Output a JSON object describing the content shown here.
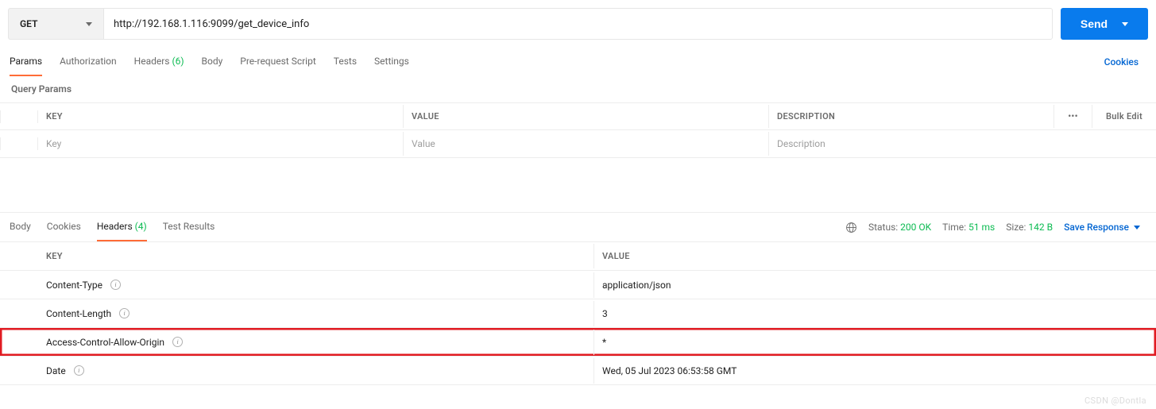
{
  "request": {
    "method": "GET",
    "url": "http://192.168.1.116:9099/get_device_info",
    "send_label": "Send"
  },
  "req_tabs": {
    "params": "Params",
    "authorization": "Authorization",
    "headers": "Headers",
    "headers_count": "(6)",
    "body": "Body",
    "prerequest": "Pre-request Script",
    "tests": "Tests",
    "settings": "Settings",
    "cookies_link": "Cookies"
  },
  "query": {
    "section_label": "Query Params",
    "header_key": "KEY",
    "header_value": "VALUE",
    "header_description": "DESCRIPTION",
    "actions_dots": "•••",
    "bulk_edit": "Bulk Edit",
    "key_placeholder": "Key",
    "value_placeholder": "Value",
    "description_placeholder": "Description"
  },
  "resp_tabs": {
    "body": "Body",
    "cookies": "Cookies",
    "headers": "Headers",
    "headers_count": "(4)",
    "test_results": "Test Results"
  },
  "status": {
    "status_label": "Status:",
    "status_value": "200 OK",
    "time_label": "Time:",
    "time_value": "51 ms",
    "size_label": "Size:",
    "size_value": "142 B",
    "save_response": "Save Response"
  },
  "resp_headers": {
    "header_key": "KEY",
    "header_value": "VALUE",
    "rows": [
      {
        "key": "Content-Type",
        "value": "application/json",
        "highlight": false
      },
      {
        "key": "Content-Length",
        "value": "3",
        "highlight": false
      },
      {
        "key": "Access-Control-Allow-Origin",
        "value": "*",
        "highlight": true
      },
      {
        "key": "Date",
        "value": "Wed, 05 Jul 2023 06:53:58 GMT",
        "highlight": false
      }
    ]
  },
  "watermark": "CSDN @Dontla"
}
